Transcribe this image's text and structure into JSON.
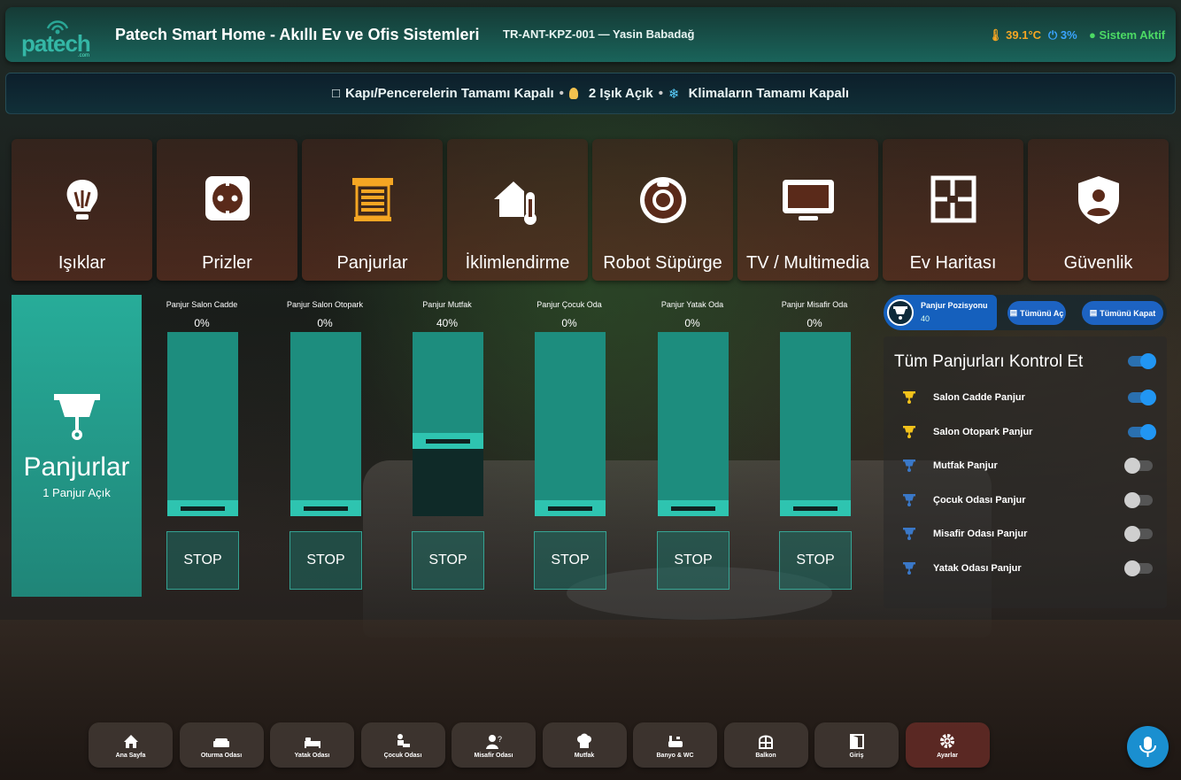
{
  "header": {
    "logo_text": "patech",
    "logo_sub": ".com",
    "title": "Patech Smart Home - Akıllı Ev ve Ofis Sistemleri",
    "device": "TR-ANT-KPZ-001 — Yasin Babadağ",
    "temperature": "39.1°C",
    "humidity": "3%",
    "system_status": "Sistem Aktif"
  },
  "status_bar": {
    "doors": "Kapı/Pencerelerin Tamamı Kapalı",
    "lights": "2 Işık Açık",
    "climate": "Klimaların Tamamı Kapalı",
    "separator": "•"
  },
  "categories": [
    {
      "label": "Işıklar",
      "icon": "lightbulb-icon"
    },
    {
      "label": "Prizler",
      "icon": "power-socket-icon"
    },
    {
      "label": "Panjurlar",
      "icon": "blinds-icon"
    },
    {
      "label": "İklimlendirme",
      "icon": "home-thermometer-icon"
    },
    {
      "label": "Robot Süpürge",
      "icon": "robot-vacuum-icon"
    },
    {
      "label": "TV / Multimedia",
      "icon": "tv-icon"
    },
    {
      "label": "Ev Haritası",
      "icon": "floorplan-icon"
    },
    {
      "label": "Güvenlik",
      "icon": "shield-user-icon"
    }
  ],
  "summary_card": {
    "title": "Panjurlar",
    "subtitle": "1 Panjur Açık"
  },
  "shutters": [
    {
      "name": "Panjur Salon Cadde",
      "percent": "0%",
      "position": 0,
      "stop": "STOP"
    },
    {
      "name": "Panjur Salon Otopark",
      "percent": "0%",
      "position": 0,
      "stop": "STOP"
    },
    {
      "name": "Panjur Mutfak",
      "percent": "40%",
      "position": 40,
      "stop": "STOP"
    },
    {
      "name": "Panjur Çocuk Oda",
      "percent": "0%",
      "position": 0,
      "stop": "STOP"
    },
    {
      "name": "Panjur Yatak Oda",
      "percent": "0%",
      "position": 0,
      "stop": "STOP"
    },
    {
      "name": "Panjur Misafir Oda",
      "percent": "0%",
      "position": 0,
      "stop": "STOP"
    }
  ],
  "position_control": {
    "label": "Panjur Pozisyonu",
    "value": "40",
    "open_all": "Tümünü Aç",
    "close_all": "Tümünü Kapat"
  },
  "control_panel": {
    "title": "Tüm Panjurları Kontrol Et",
    "master_on": true,
    "items": [
      {
        "label": "Salon Cadde Panjur",
        "on": true,
        "icon_color": "#f2c21b"
      },
      {
        "label": "Salon Otopark Panjur",
        "on": true,
        "icon_color": "#f2c21b"
      },
      {
        "label": "Mutfak Panjur",
        "on": false,
        "icon_color": "#3a78c8"
      },
      {
        "label": "Çocuk Odası Panjur",
        "on": false,
        "icon_color": "#3a78c8"
      },
      {
        "label": "Misafir Odası Panjur",
        "on": false,
        "icon_color": "#3a78c8"
      },
      {
        "label": "Yatak Odası Panjur",
        "on": false,
        "icon_color": "#3a78c8"
      }
    ]
  },
  "nav": [
    {
      "label": "Ana Sayfa",
      "icon": "home-icon"
    },
    {
      "label": "Oturma Odası",
      "icon": "sofa-icon"
    },
    {
      "label": "Yatak Odası",
      "icon": "bed-icon"
    },
    {
      "label": "Çocuk Odası",
      "icon": "child-icon"
    },
    {
      "label": "Misafir Odası",
      "icon": "guest-icon"
    },
    {
      "label": "Mutfak",
      "icon": "chef-hat-icon"
    },
    {
      "label": "Banyo & WC",
      "icon": "bath-icon"
    },
    {
      "label": "Balkon",
      "icon": "balcony-icon"
    },
    {
      "label": "Giriş",
      "icon": "door-icon"
    },
    {
      "label": "Ayarlar",
      "icon": "gear-icon",
      "active": true
    }
  ],
  "colors": {
    "accent": "#2ec4b0",
    "brand_blue": "#1d63c2",
    "warn": "#f5a623",
    "ok": "#4cd964"
  }
}
